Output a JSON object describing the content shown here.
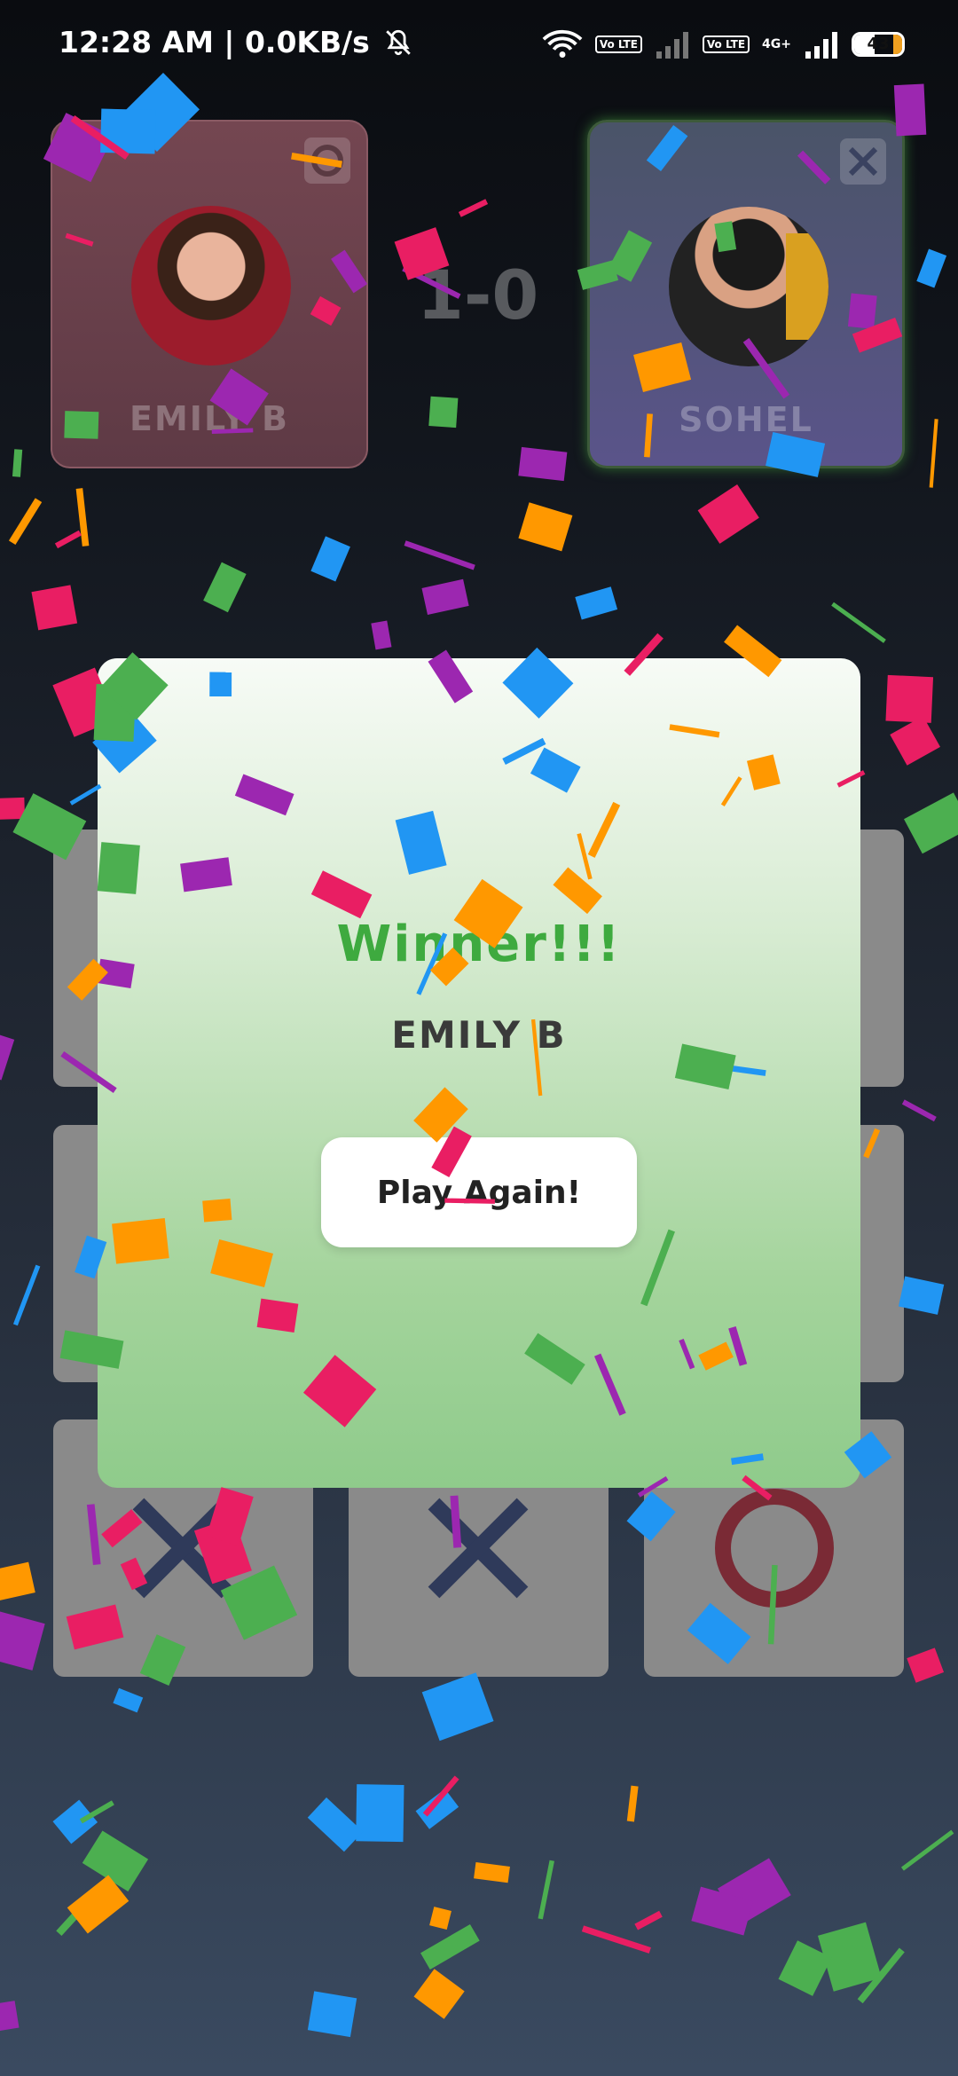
{
  "status_bar": {
    "time": "12:28 AM | 0.0KB/s",
    "icons": [
      "mute-icon",
      "wifi-icon",
      "volte-icon",
      "signal-icon",
      "volte-icon",
      "signal-4g-icon",
      "battery-icon"
    ],
    "volte_label": "Vo LTE",
    "network_label": "4G+",
    "battery_level": "43"
  },
  "players": [
    {
      "name": "EMILY B",
      "mark": "O",
      "mark_icon": "o-mark-icon"
    },
    {
      "name": "SOHEL",
      "mark": "X",
      "mark_icon": "x-mark-icon"
    }
  ],
  "score": "1-0",
  "board": [
    "",
    "",
    "",
    "",
    "",
    "",
    "X",
    "X",
    "O"
  ],
  "modal": {
    "title": "Winner!!!",
    "winner_name": "EMILY B",
    "play_again_label": "Play Again!"
  },
  "colors": {
    "winner_title": "#3eaa3f",
    "x_mark": "#2f3a5a",
    "o_mark": "#7a2a35",
    "confetti": [
      "#e91e63",
      "#2196f3",
      "#4caf50",
      "#ff9800",
      "#9c27b0"
    ]
  }
}
